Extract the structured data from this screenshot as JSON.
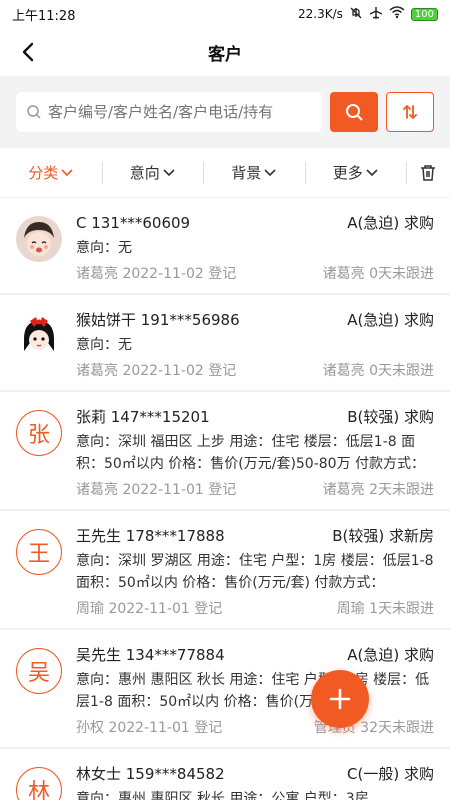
{
  "status": {
    "time": "上午11:28",
    "speed": "22.3K/s",
    "battery": "100"
  },
  "header": {
    "title": "客户"
  },
  "search": {
    "placeholder": "客户编号/客户姓名/客户电话/持有"
  },
  "filters": [
    "分类",
    "意向",
    "背景",
    "更多"
  ],
  "customers": [
    {
      "avatar_letter": "",
      "avatar_type": "img1",
      "name": "C 131***60609",
      "level": "A(急迫) 求购",
      "intent": "意向：无",
      "registrar": "诸葛亮 2022-11-02 登记",
      "follow": "诸葛亮  0天未跟进"
    },
    {
      "avatar_letter": "",
      "avatar_type": "img2",
      "name": "猴姑饼干 191***56986",
      "level": "A(急迫) 求购",
      "intent": "意向：无",
      "registrar": "诸葛亮 2022-11-02 登记",
      "follow": "诸葛亮  0天未跟进"
    },
    {
      "avatar_letter": "张",
      "avatar_type": "letter",
      "name": "张莉 147***15201",
      "level": "B(较强) 求购",
      "intent": "意向：深圳 福田区 上步 用途：住宅 楼层：低层1-8 面积：50㎡以内 价格：售价(万元/套)50-80万 付款方式：",
      "registrar": "诸葛亮 2022-11-01 登记",
      "follow": "诸葛亮  2天未跟进"
    },
    {
      "avatar_letter": "王",
      "avatar_type": "letter",
      "name": "王先生 178***17888",
      "level": "B(较强) 求新房",
      "intent": "意向：深圳 罗湖区 用途：住宅 户型：1房 楼层：低层1-8 面积：50㎡以内 价格：售价(万元/套) 付款方式：",
      "registrar": "周瑜 2022-11-01 登记",
      "follow": "周瑜  1天未跟进"
    },
    {
      "avatar_letter": "吴",
      "avatar_type": "letter",
      "name": "吴先生 134***77884",
      "level": "A(急迫) 求购",
      "intent": "意向：惠州 惠阳区 秋长 用途：住宅 户型：2房 楼层：低层1-8 面积：50㎡以内 价格：售价(万元/套)",
      "registrar": "孙权 2022-11-01 登记",
      "follow": "管理员  32天未跟进"
    },
    {
      "avatar_letter": "林",
      "avatar_type": "letter",
      "name": "林女士 159***84582",
      "level": "C(一般) 求购",
      "intent": "意向：惠州 惠阳区 秋长 用途：公寓 户型：3房",
      "registrar": "",
      "follow": ""
    }
  ],
  "colors": {
    "accent": "#f15a22"
  }
}
